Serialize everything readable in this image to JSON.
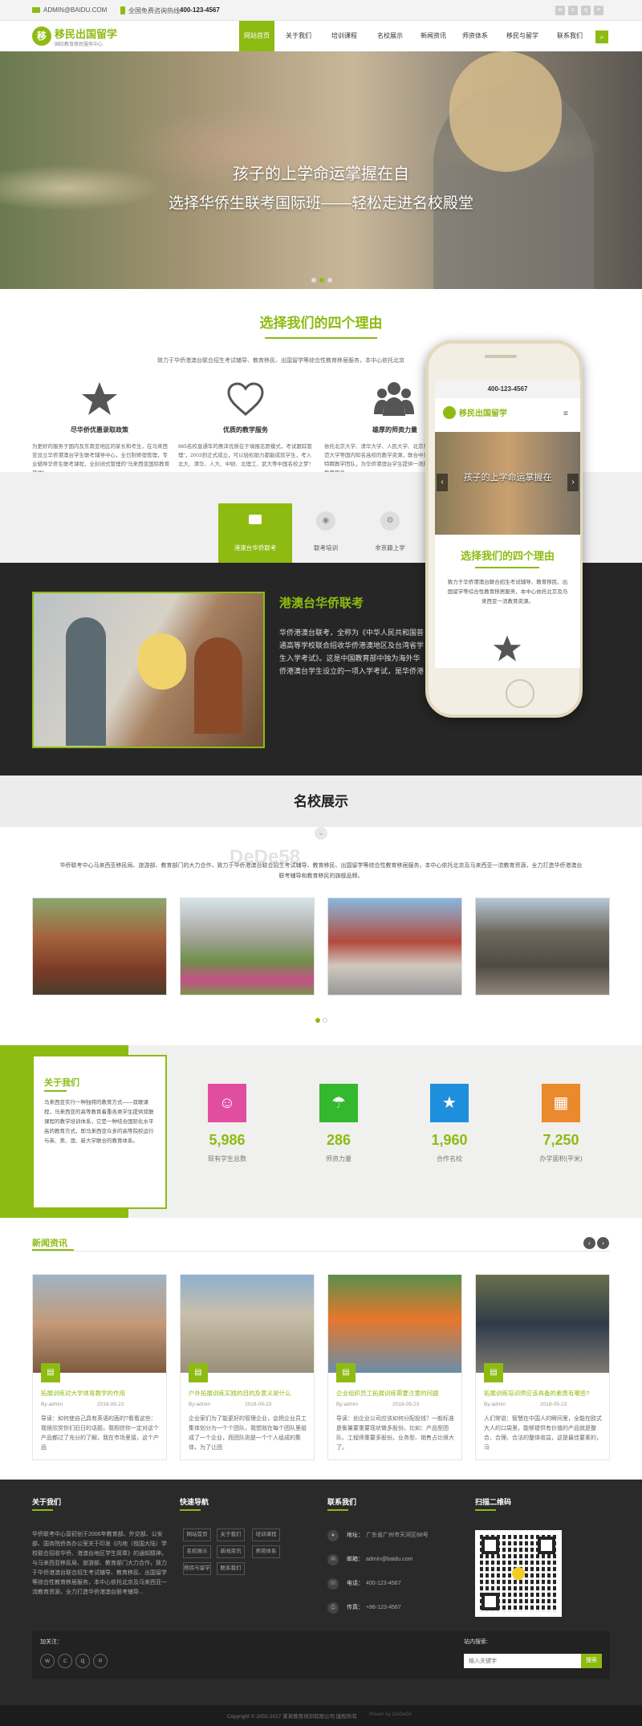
{
  "topbar": {
    "email": "ADMIN@BAIDU.COM",
    "hotline_label": "全国免费咨询热线:",
    "hotline": "400-123-4567"
  },
  "brand": {
    "name": "移民出国留学",
    "slogan": "国际教育移民服务中心",
    "accent": "#8dbb12"
  },
  "nav": [
    "网站首页",
    "关于我们",
    "培训课程",
    "名校展示",
    "新闻资讯",
    "师资体系",
    "移民与留学",
    "联系我们"
  ],
  "hero": {
    "line1": "孩子的上学命运掌握在自",
    "line2": "选择华侨生联考国际班——轻松走进名校殿堂"
  },
  "reasons": {
    "title": "选择我们的四个理由",
    "intro": "致力于华侨港澳台联合招生考试辅导、教育移民、出国留学等综合性教育移居服务，本中心依托北京",
    "items": [
      {
        "icon": "star-icon",
        "title": "尽华侨优惠录取政策",
        "text": "为更好的服务于国内及东南亚地区的家长和考生，在马来西亚设立华侨港澳台学生联考辅导中心，全日制寄宿管理，专业辅导华侨生联考课程，全封闭式管理的“马来西亚国际教育基地”"
      },
      {
        "icon": "heart-icon",
        "title": "优质的教学服务",
        "text": "965名校直通车的惠泽优质在于填报志愿模式，考试跟踪管理”，2003到正式成立，可以轻松助力都能成就学生，考入北大、清华、人大、中财、北理工、武大等中国名校之梦！"
      },
      {
        "icon": "group-icon",
        "title": "雄厚的师资力量",
        "text": "依托北京大学、清华大学、人民大学、北京师范大学等国内知名高校的教学资源，联合中外特聘教学团队，为华侨港澳台学生提供一流的教育服务"
      }
    ]
  },
  "tabs": [
    {
      "label": "港澳台华侨联考",
      "icon": "briefcase-icon"
    },
    {
      "label": "联考培训",
      "icon": "eye-icon"
    },
    {
      "label": "非京籍上学",
      "icon": "gears-icon"
    }
  ],
  "feature": {
    "title": "港澳台华侨联考",
    "text": "华侨港澳台联考，全称为《中华人民共和国普通高等学校联合招收华侨港澳地区及台湾省学生入学考试》。这是中国教育部中独为海外华侨港澳台学生设立的一项入学考试，是华侨港澳台学生进入中国内地大学的主要途径。"
  },
  "phone": {
    "hotline": "400-123-4567",
    "hero": "孩子的上学命运掌握在",
    "reason_title": "选择我们的四个理由",
    "reason_text": "致力于华侨港澳台联合招生考试辅导、教育移民、出国留学等综合性教育移居服务，本中心依托北京及马来西亚一流教育资源。"
  },
  "schools": {
    "title": "名校展示",
    "intro": "华侨联考中心马来西亚移民局、旅游部、教育部门的大力合作，致力于华侨港澳台联合招生考试辅导、教育移民、出国留学等综合性教育移居服务，本中心依托北京及马来西亚一流教育资源，全力打造华侨港澳台联考辅导和教育移民的旗舰品牌。",
    "watermark": "DeDe58"
  },
  "about": {
    "title": "关于我们",
    "text": "马来西亚实行一种独特的教育方式——双联课程，马来西亚的高等教育着重各类学生提供双联课程的教学培训体系，它是一种结合国际化水平高的教育方式，即马来西亚众多的高等院校运行与英、美、澳、新大学联合的教育体系。"
  },
  "stats": [
    {
      "value": "5,986",
      "label": "现有学生总数",
      "icon": "students-icon",
      "color": "#e14ea1"
    },
    {
      "value": "286",
      "label": "师资力量",
      "icon": "umbrella-icon",
      "color": "#33b82e"
    },
    {
      "value": "1,960",
      "label": "合作名校",
      "icon": "star-icon",
      "color": "#1e8fdc"
    },
    {
      "value": "7,250",
      "label": "办学面积(平米)",
      "icon": "building-icon",
      "color": "#ea8a2c"
    }
  ],
  "news": {
    "title": "新闻资讯",
    "items": [
      {
        "title": "拓展训练对大学体育教学的作用",
        "author": "By:admin",
        "date": "2018-09-23",
        "text": "导读：如何使自己具有英语的面的?看看这些：我很欣赏你们旧日的话题，我相信你一定对这个产品都过了充分的了解，我在市场里接，这个产品"
      },
      {
        "title": "户外拓展训练实践的目的及意义是什么",
        "author": "By:admin",
        "date": "2018-09-23",
        "text": "企业家们为了能更好的管理企业，会把企业员工集体划分为一个个团队，我想就在每个团队里组成了一个企业，而团队则是一个个人组成的集体，为了让团"
      },
      {
        "title": "企业组织员工拓展训练需要注意的问题",
        "author": "By:admin",
        "date": "2018-09-23",
        "text": "导读：创企业公司应该如何分配投钱？一般标准是衡量要重要现状做多股份。比如：产品型团队、工程师重要多股份。业务型、销售占比很大了。"
      },
      {
        "title": "拓展训练培训师应该具备的素质有哪些?",
        "author": "By:admin",
        "date": "2018-09-23",
        "text": "人们常说：智慧在中国人的瞬间里，全能在欧式大人的口袋里。能够提供有价值的产品就是整合、合理、合法的整体收益，这是最佳要素的，马"
      }
    ]
  },
  "footer": {
    "about_title": "关于我们",
    "about_text": "华侨联考中心营初创于2006年教育部、外交部、公安部、国务院侨务办公室关于印发《内地（祖国大陆）学校联合招收华侨、港澳台地区学生简章》的通知精神，与马来西亚移民局、旅游部、教育部门大力合作，致力于华侨港澳台联合招生考试辅导、教育移民、出国留学等综合性教育移居服务，本中心依托北京及马来西亚一流教育资源，全力打造华侨港澳台联考辅导...",
    "links_title": "快速导航",
    "links": [
      "网站首页",
      "关于我们",
      "培训课程",
      "名校展示",
      "新闻资讯",
      "师资体系",
      "移民与留学",
      "联系我们"
    ],
    "contact_title": "联系我们",
    "contact": [
      {
        "icon": "location-icon",
        "label": "地址：",
        "value": "广东省广州市天河区68号"
      },
      {
        "icon": "mail-icon",
        "label": "邮箱：",
        "value": "admin@baidu.com"
      },
      {
        "icon": "phone-icon",
        "label": "电话：",
        "value": "400-123-4567"
      },
      {
        "icon": "fax-icon",
        "label": "传真：",
        "value": "+86-123-4567"
      }
    ],
    "qr_title": "扫描二维码",
    "follow_label": "加关注：",
    "search_label": "站内搜索:",
    "search_placeholder": "输入关键字",
    "search_button": "搜索",
    "copyright": "Copyright © 2002-2017 某某教育培训有限公司 版权所有",
    "powered": "Power by DeDe58"
  }
}
